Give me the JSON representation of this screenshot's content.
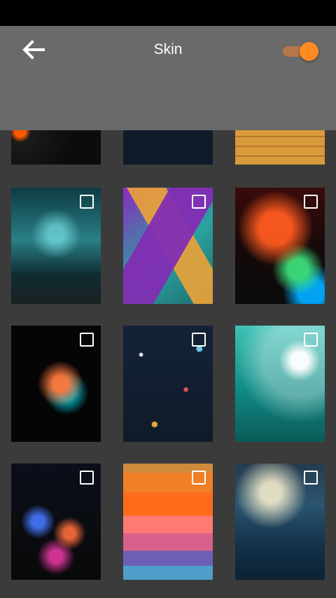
{
  "header": {
    "title": "Skin",
    "back_icon": "back-arrow-icon",
    "toggle": {
      "state": "on",
      "accent": "#ff8a23",
      "track": "#b6764a"
    }
  },
  "grid": {
    "rows": [
      {
        "row": "top-partial",
        "items": [
          {
            "name": "skin-tile-1",
            "checked": false
          },
          {
            "name": "skin-tile-2",
            "checked": false
          },
          {
            "name": "skin-tile-3",
            "checked": false
          }
        ]
      },
      {
        "row": "1",
        "items": [
          {
            "name": "skin-tile-4",
            "checked": false
          },
          {
            "name": "skin-tile-5",
            "checked": false
          },
          {
            "name": "skin-tile-6",
            "checked": false
          }
        ]
      },
      {
        "row": "2",
        "items": [
          {
            "name": "skin-tile-7",
            "checked": false
          },
          {
            "name": "skin-tile-8",
            "checked": false
          },
          {
            "name": "skin-tile-9",
            "checked": false
          }
        ]
      },
      {
        "row": "3",
        "items": [
          {
            "name": "skin-tile-10",
            "checked": false
          },
          {
            "name": "skin-tile-11",
            "checked": false
          },
          {
            "name": "skin-tile-12",
            "checked": false
          }
        ]
      }
    ]
  },
  "colors": {
    "status_bar": "#000000",
    "app_bar": "#6a6a6a",
    "background": "#3b3b3b",
    "checkbox_border": "#ffffff"
  }
}
